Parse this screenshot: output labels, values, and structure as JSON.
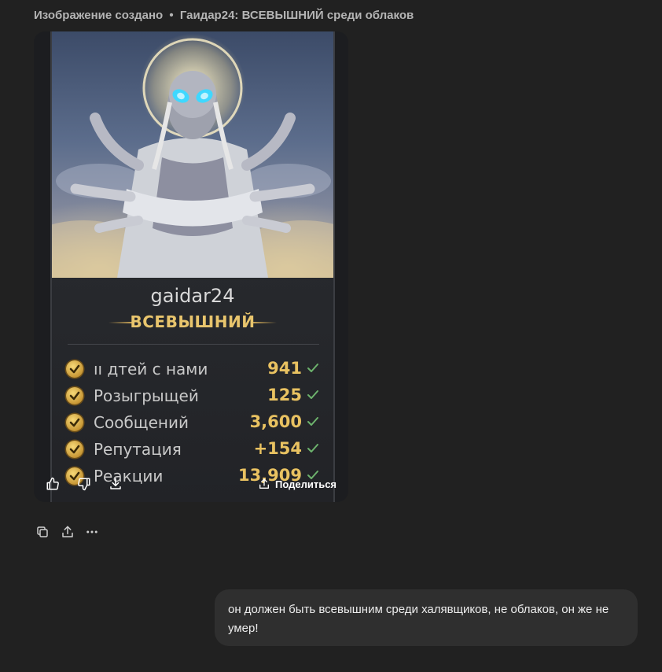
{
  "caption": {
    "prefix": "Изображение создано",
    "separator": "•",
    "title": "Гаидар24: ВСЕВЫШНИЙ среди облаков"
  },
  "card": {
    "username": "gaidar24",
    "rank": "ВСЕВЫШНИЙ",
    "stats": [
      {
        "label": "ıı дтей с нами",
        "value": "941"
      },
      {
        "label": "Розыгрыщей",
        "value": "125"
      },
      {
        "label": "Сообщений",
        "value": "3,600"
      },
      {
        "label": "Репутация",
        "value": "+154"
      },
      {
        "label": "Реакции",
        "value": "13,909"
      }
    ]
  },
  "image_actions": {
    "share_label": "Поделиться",
    "icons": [
      "thumbs-up-icon",
      "thumbs-down-icon",
      "download-icon",
      "share-icon"
    ]
  },
  "message_actions": {
    "icons": [
      "copy-icon",
      "share-icon",
      "more-icon"
    ]
  },
  "user_message": {
    "text": "он должен быть всевышним среди халявщиков, не облаков, он же не умер!"
  },
  "colors": {
    "background": "#212121",
    "bubble": "#2f2f2f",
    "gold": "#e9c261",
    "check_green": "#6db36d"
  }
}
